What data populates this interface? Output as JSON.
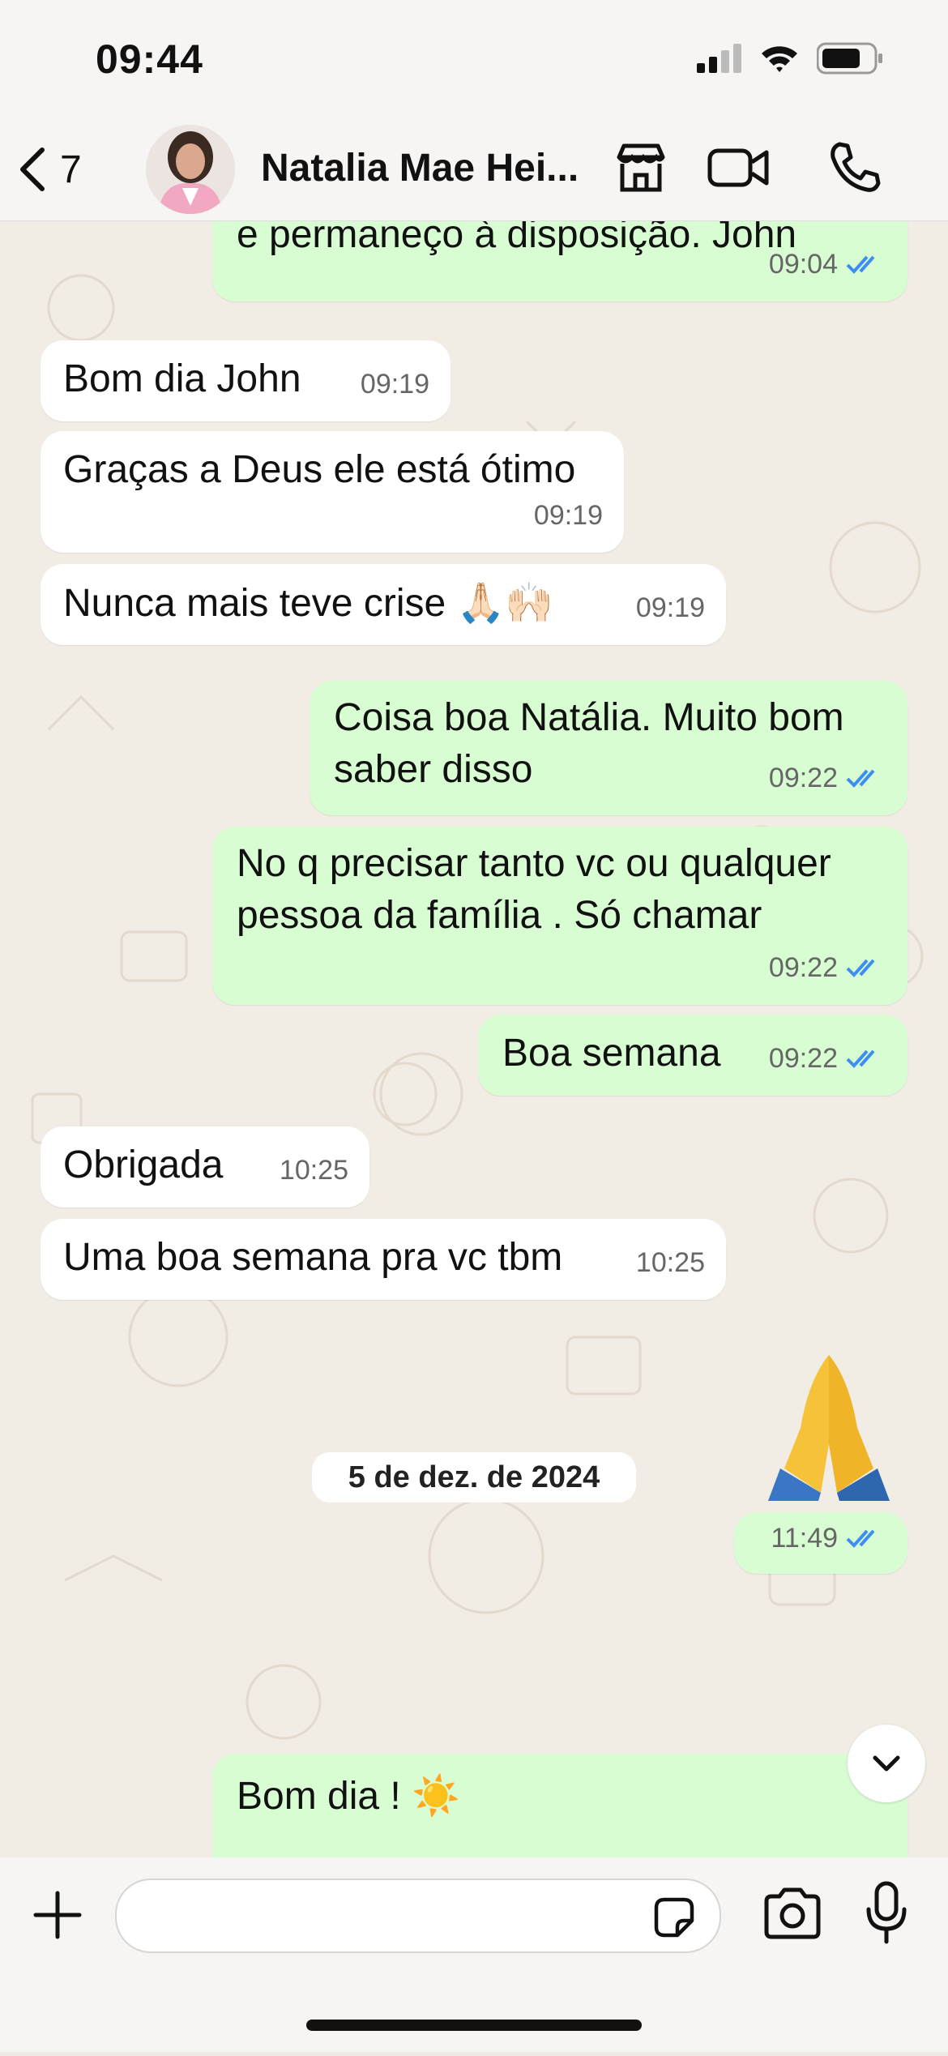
{
  "status_bar": {
    "time": "09:44"
  },
  "header": {
    "back_count": "7",
    "contact_name": "Natalia Mae Hei..."
  },
  "messages": [
    {
      "direction": "out",
      "text": "e permaneço à disposição. John",
      "time": "09:04",
      "read": true
    },
    {
      "direction": "in",
      "text": "Bom dia John",
      "time": "09:19"
    },
    {
      "direction": "in",
      "text": "Graças a Deus ele está ótimo",
      "time": "09:19"
    },
    {
      "direction": "in",
      "text": "Nunca mais teve crise",
      "emoji": "🙏🏻🙌🏻",
      "time": "09:19"
    },
    {
      "direction": "out",
      "text_line1": "Coisa boa Natália. Muito bom",
      "text_line2": "saber disso",
      "time": "09:22",
      "read": true
    },
    {
      "direction": "out",
      "text_line1": "No q precisar tanto vc ou qualquer",
      "text_line2": "pessoa da família . Só chamar",
      "time": "09:22",
      "read": true
    },
    {
      "direction": "out",
      "text": "Boa semana",
      "time": "09:22",
      "read": true
    },
    {
      "direction": "in",
      "text": "Obrigada",
      "time": "10:25"
    },
    {
      "direction": "in",
      "text": "Uma boa semana pra vc tbm",
      "time": "10:25"
    },
    {
      "direction": "out",
      "emoji": "🙏",
      "time": "11:49",
      "read": true
    },
    {
      "direction": "out",
      "text": "Bom dia !",
      "emoji": "☀️"
    }
  ],
  "date_separator": "5 de dez. de 2024",
  "colors": {
    "incoming_bubble": "#ffffff",
    "outgoing_bubble": "#d9fdd3",
    "read_ticks": "#3d8ef0",
    "background": "#efeae2"
  },
  "icons": [
    "back-chevron-icon",
    "store-icon",
    "video-camera-icon",
    "phone-icon",
    "plus-icon",
    "sticker-icon",
    "camera-icon",
    "microphone-icon",
    "chevron-down-icon",
    "signal-icon",
    "wifi-icon",
    "battery-icon"
  ]
}
